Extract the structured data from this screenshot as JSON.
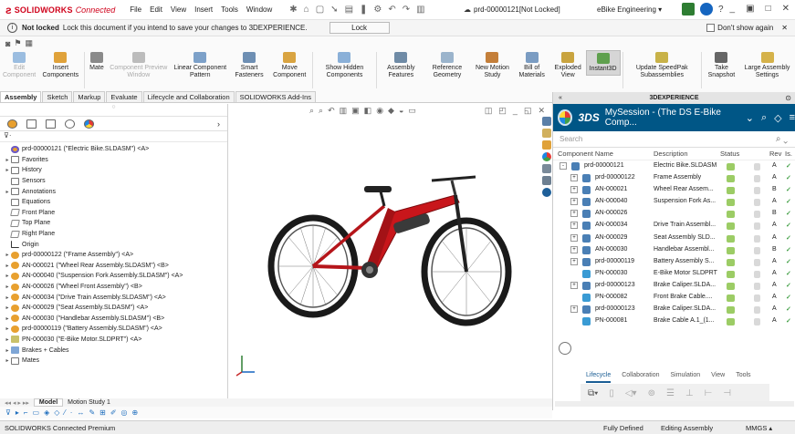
{
  "app": {
    "brand": "SOLIDWORKS",
    "brand_suffix": "Connected",
    "menus": [
      "File",
      "Edit",
      "View",
      "Insert",
      "Tools",
      "Window"
    ],
    "document_title": "prd-00000121[Not Locked]",
    "tenant": "eBike Engineering"
  },
  "infobar": {
    "not_locked": "Not locked",
    "message": "Lock this document if you intend to save your changes to 3DEXPERIENCE.",
    "lock_button": "Lock",
    "dont_show": "Don't show again"
  },
  "commands": [
    {
      "label": "Edit Component",
      "disabled": true,
      "color": "#9bbde0"
    },
    {
      "label": "Insert Components",
      "disabled": false,
      "color": "#e0a23a"
    },
    {
      "label": "Mate",
      "disabled": false,
      "color": "#8a8a8a"
    },
    {
      "label": "Component Preview Window",
      "disabled": true,
      "color": "#bcbcbc"
    },
    {
      "label": "Linear Component Pattern",
      "disabled": false,
      "color": "#7da1c9"
    },
    {
      "label": "Smart Fasteners",
      "disabled": false,
      "color": "#6e8fb3"
    },
    {
      "label": "Move Component",
      "disabled": false,
      "color": "#d9a441"
    },
    {
      "label": "Show Hidden Components",
      "disabled": false,
      "color": "#8ab0d8"
    },
    {
      "label": "Assembly Features",
      "disabled": false,
      "color": "#6f8ba6"
    },
    {
      "label": "Reference Geometry",
      "disabled": false,
      "color": "#9bb4cc"
    },
    {
      "label": "New Motion Study",
      "disabled": false,
      "color": "#c47f3a"
    },
    {
      "label": "Bill of Materials",
      "disabled": false,
      "color": "#7a9cc2"
    },
    {
      "label": "Exploded View",
      "disabled": false,
      "color": "#c9a43f"
    },
    {
      "label": "Instant3D",
      "disabled": false,
      "color": "#5fa04e",
      "active": true
    },
    {
      "label": "Update SpeedPak Subassemblies",
      "disabled": false,
      "color": "#c8b248"
    },
    {
      "label": "Take Snapshot",
      "disabled": false,
      "color": "#666666"
    },
    {
      "label": "Large Assembly Settings",
      "disabled": false,
      "color": "#d5b24a"
    }
  ],
  "tabs": [
    "Assembly",
    "Sketch",
    "Markup",
    "Evaluate",
    "Lifecycle and Collaboration",
    "SOLIDWORKS Add-Ins"
  ],
  "tree": [
    {
      "label": "prd-00000121 (\"Electric Bike.SLDASM\") <A>",
      "icon": "asmroot",
      "indent": 0,
      "exp": ""
    },
    {
      "label": "Favorites",
      "icon": "fold",
      "indent": 1,
      "exp": "▸"
    },
    {
      "label": "History",
      "icon": "fold",
      "indent": 1,
      "exp": "▸"
    },
    {
      "label": "Sensors",
      "icon": "fold",
      "indent": 1,
      "exp": ""
    },
    {
      "label": "Annotations",
      "icon": "fold",
      "indent": 1,
      "exp": "▸"
    },
    {
      "label": "Equations",
      "icon": "fold",
      "indent": 1,
      "exp": ""
    },
    {
      "label": "Front Plane",
      "icon": "plane",
      "indent": 1,
      "exp": ""
    },
    {
      "label": "Top Plane",
      "icon": "plane",
      "indent": 1,
      "exp": ""
    },
    {
      "label": "Right Plane",
      "icon": "plane",
      "indent": 1,
      "exp": ""
    },
    {
      "label": "Origin",
      "icon": "origin",
      "indent": 1,
      "exp": ""
    },
    {
      "label": "prd-00000122 (\"Frame Assembly\") <A>",
      "icon": "asm",
      "indent": 1,
      "exp": "▸"
    },
    {
      "label": "AN-000021 (\"Wheel Rear Assembly.SLDASM\") <B>",
      "icon": "asm",
      "indent": 1,
      "exp": "▸"
    },
    {
      "label": "AN-000040 (\"Suspension Fork Assembly.SLDASM\") <A>",
      "icon": "asm",
      "indent": 1,
      "exp": "▸"
    },
    {
      "label": "AN-000026 (\"Wheel Front Assembly\") <B>",
      "icon": "asm",
      "indent": 1,
      "exp": "▸"
    },
    {
      "label": "AN-000034 (\"Drive Train Assembly.SLDASM\") <A>",
      "icon": "asm",
      "indent": 1,
      "exp": "▸"
    },
    {
      "label": "AN-000029 (\"Seat Assembly.SLDASM\") <A>",
      "icon": "asm",
      "indent": 1,
      "exp": "▸"
    },
    {
      "label": "AN-000030 (\"Handlebar Assembly.SLDASM\") <B>",
      "icon": "asm",
      "indent": 1,
      "exp": "▸"
    },
    {
      "label": "prd-00000119 (\"Battery Assembly.SLDASM\") <A>",
      "icon": "asm",
      "indent": 1,
      "exp": "▸"
    },
    {
      "label": "PN-000030 (\"E-Bike Motor.SLDPRT\") <A>",
      "icon": "part",
      "indent": 1,
      "exp": "▸"
    },
    {
      "label": "Brakes + Cables",
      "icon": "brakes",
      "indent": 1,
      "exp": "▸"
    },
    {
      "label": "Mates",
      "icon": "mates",
      "indent": 1,
      "exp": "▸"
    }
  ],
  "dx": {
    "header": "3DEXPERIENCE",
    "brand": "3DS",
    "session": "MySession - (The DS E-Bike Comp...",
    "search_placeholder": "Search",
    "columns": {
      "name": "Component Name",
      "desc": "Description",
      "status": "Status",
      "rev": "Rev",
      "is": "Is."
    },
    "rows": [
      {
        "indent": 0,
        "expand": "-",
        "type": "asm",
        "name": "prd-00000121",
        "desc": "Electric Bike.SLDASM",
        "rev": "A"
      },
      {
        "indent": 1,
        "expand": "+",
        "type": "asm",
        "name": "prd-00000122",
        "desc": "Frame Assembly",
        "rev": "A"
      },
      {
        "indent": 1,
        "expand": "+",
        "type": "asm",
        "name": "AN-000021",
        "desc": "Wheel Rear Assem...",
        "rev": "B"
      },
      {
        "indent": 1,
        "expand": "+",
        "type": "asm",
        "name": "AN-000040",
        "desc": "Suspension Fork As...",
        "rev": "A"
      },
      {
        "indent": 1,
        "expand": "+",
        "type": "asm",
        "name": "AN-000026",
        "desc": "",
        "rev": "B"
      },
      {
        "indent": 1,
        "expand": "+",
        "type": "asm",
        "name": "AN-000034",
        "desc": "Drive Train Assembl...",
        "rev": "A"
      },
      {
        "indent": 1,
        "expand": "+",
        "type": "asm",
        "name": "AN-000029",
        "desc": "Seat Assembly SLD...",
        "rev": "A"
      },
      {
        "indent": 1,
        "expand": "+",
        "type": "asm",
        "name": "AN-000030",
        "desc": "Handlebar Assembl...",
        "rev": "B"
      },
      {
        "indent": 1,
        "expand": "+",
        "type": "asm",
        "name": "prd-00000119",
        "desc": "Battery Assembly S...",
        "rev": "A"
      },
      {
        "indent": 1,
        "expand": "",
        "type": "part",
        "name": "PN-000030",
        "desc": "E-Bike Motor SLDPRT",
        "rev": "A"
      },
      {
        "indent": 1,
        "expand": "+",
        "type": "asm",
        "name": "prd-00000123",
        "desc": "Brake Caliper.SLDA...",
        "rev": "A"
      },
      {
        "indent": 1,
        "expand": "",
        "type": "part",
        "name": "PN-000082",
        "desc": "Front Brake Cable....",
        "rev": "A"
      },
      {
        "indent": 1,
        "expand": "+",
        "type": "asm",
        "name": "prd-00000123",
        "desc": "Brake Caliper.SLDA...",
        "rev": "A"
      },
      {
        "indent": 1,
        "expand": "",
        "type": "part",
        "name": "PN-000081",
        "desc": "Brake Cable A.1_(1...",
        "rev": "A"
      }
    ],
    "tabs": [
      "Lifecycle",
      "Collaboration",
      "Simulation",
      "View",
      "Tools"
    ]
  },
  "bottom_tabs": [
    "Model",
    "Motion Study 1"
  ],
  "status": {
    "left": "SOLIDWORKS Connected Premium",
    "defined": "Fully Defined",
    "editing": "Editing Assembly",
    "units": "MMGS"
  },
  "colors": {
    "brand_red": "#d0021b",
    "dx_blue": "#005686",
    "accent_green": "#43a047"
  }
}
